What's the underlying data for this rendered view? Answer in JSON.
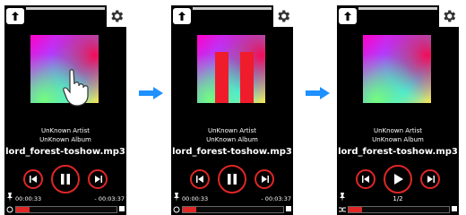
{
  "colors": {
    "accent": "#e02626",
    "arrow": "#1e90ff"
  },
  "screens": [
    {
      "artist": "UnKnown Artist",
      "album": "UnKnown Album",
      "track": "lord_forest-toshow.mp3",
      "elapsed": "00:00:33",
      "remaining": "- 00:03:37",
      "center_control": "pause-icon",
      "progress": 0.13
    },
    {
      "artist": "UnKnown Artist",
      "album": "UnKnown Album",
      "track": "lord_forest-toshow.mp3",
      "elapsed": "00:00:33",
      "remaining": "- 00:03:37",
      "center_control": "pause-icon",
      "progress": 0.13
    },
    {
      "artist": "UnKnown Artist",
      "album": "UnKnown Album",
      "track": "lord_forest-toshow.mp3",
      "page": "1/2",
      "center_control": "play-icon",
      "progress": 0.13
    }
  ]
}
